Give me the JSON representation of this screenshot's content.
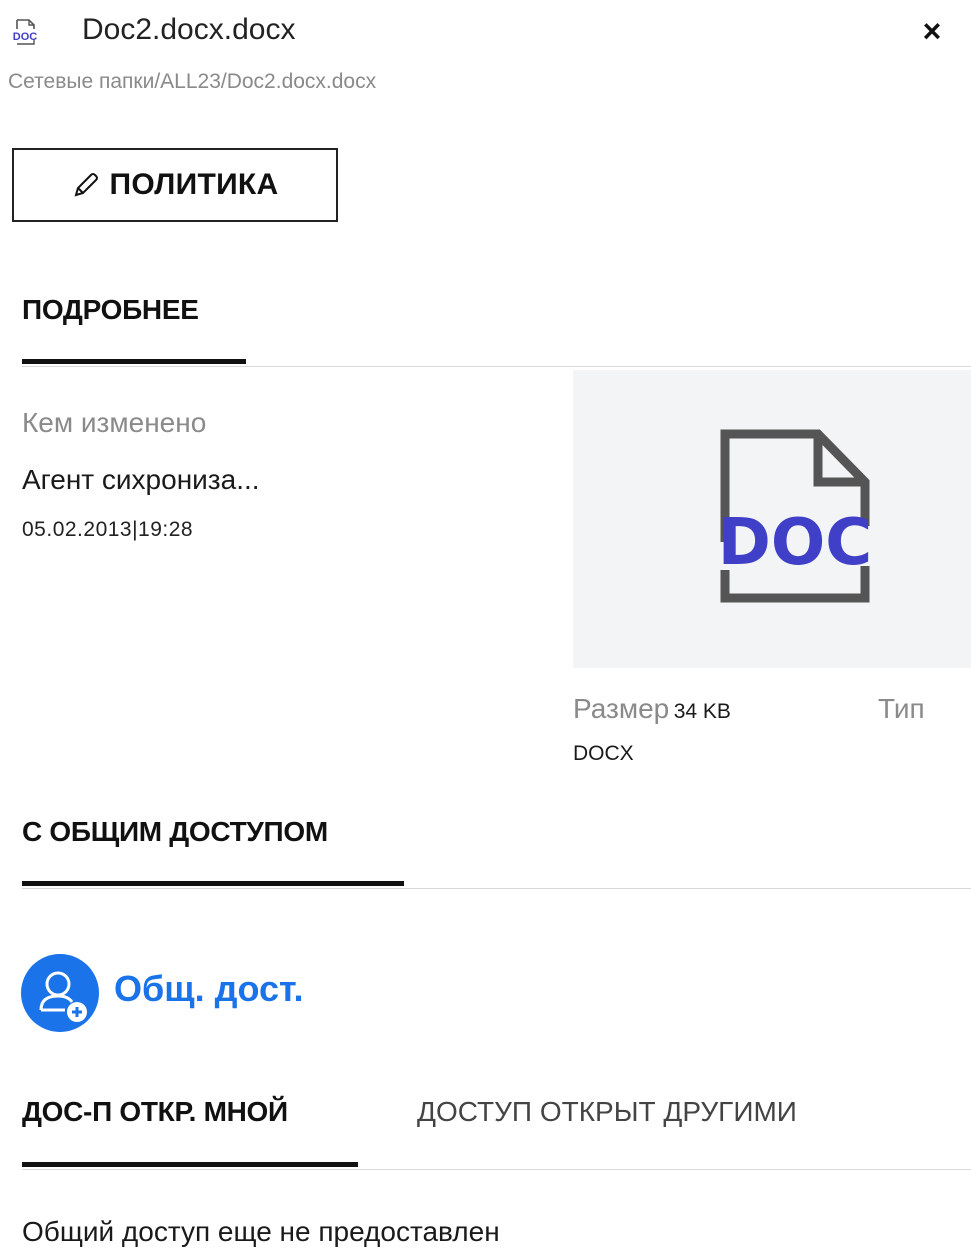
{
  "header": {
    "file_icon_label": "DOC",
    "title": "Doc2.docx.docx",
    "close_label": "×",
    "breadcrumb": "Сетевые папки/ALL23/Doc2.docx.docx"
  },
  "policy_button": {
    "label": "ПОЛИТИКА"
  },
  "details": {
    "section_title": "ПОДРОБНЕЕ",
    "modified_by_label": "Кем изменено",
    "modified_by_value": "Агент сихрониза...",
    "modified_date": "05.02.2013|19:28",
    "preview_label": "DOC",
    "size_label": "Размер",
    "size_value": "34 KB",
    "type_label": "Тип",
    "type_value": "DOCX"
  },
  "sharing": {
    "section_title": "С ОБЩИМ ДОСТУПОМ",
    "share_link": "Общ. дост.",
    "tabs": [
      {
        "label": "ДОС-П ОТКР. МНОЙ",
        "active": true
      },
      {
        "label": "ДОСТУП ОТКРЫТ ДРУГИМИ",
        "active": false
      }
    ],
    "empty_message": "Общий доступ еще не предоставлен"
  },
  "colors": {
    "accent": "#1a73e8",
    "doc_icon": "#3f3fc8",
    "preview_bg": "#f3f4f6"
  }
}
